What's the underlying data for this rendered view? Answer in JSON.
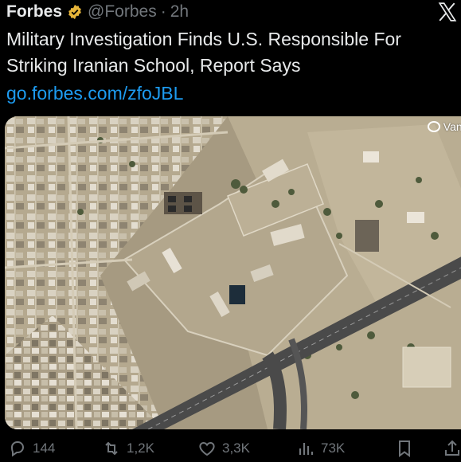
{
  "tweet": {
    "author": "Forbes",
    "handle": "@Forbes",
    "separator": "·",
    "time": "2h",
    "text": "Military Investigation Finds U.S. Responsible For Striking Iranian School, Report Says",
    "link": "go.forbes.com/zfoJBL"
  },
  "media": {
    "watermark": "Vantor"
  },
  "actions": {
    "replies": "144",
    "reposts": "1,2K",
    "likes": "3,3K",
    "views": "73K"
  },
  "icons": {
    "verified": "verified-badge-icon",
    "x_logo": "x-logo-icon",
    "reply": "reply-icon",
    "repost": "repost-icon",
    "like": "heart-icon",
    "views": "views-icon",
    "bookmark": "bookmark-icon",
    "share": "share-icon"
  },
  "colors": {
    "background": "#000000",
    "text": "#e7e9ea",
    "secondary": "#71767b",
    "link": "#1d9bf0",
    "verified": "#e8b63a"
  }
}
